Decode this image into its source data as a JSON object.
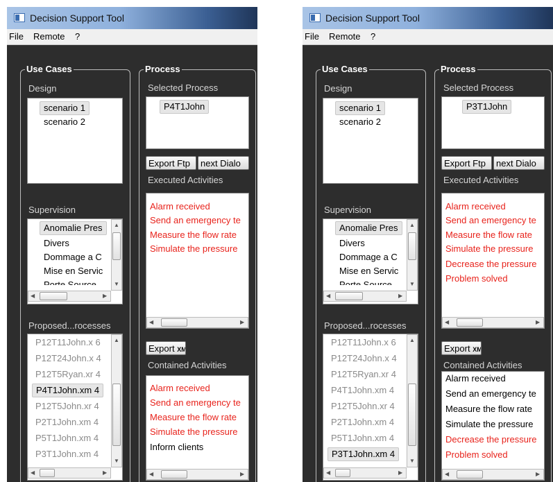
{
  "windows": [
    {
      "title": "Decision Support Tool",
      "menu": [
        "File",
        "Remote",
        "?"
      ],
      "use_cases": {
        "legend": "Use Cases",
        "design_label": "Design",
        "design_items": [
          "scenario 1",
          "scenario 2"
        ],
        "supervision_label": "Supervision",
        "supervision_items": [
          "Anomalie Pres",
          "Divers",
          "Dommage a C",
          "Mise en Servic",
          "Porte Source"
        ],
        "proposed_label": "Proposed...rocesses",
        "proposed_items": [
          "P12T11John.x 6",
          "P12T24John.x 4",
          "P12T5Ryan.xr 4",
          "P4T1John.xm 4",
          "P12T5John.xr 4",
          "P2T1John.xm 4",
          "P5T1John.xm 4",
          "P3T1John.xm 4"
        ],
        "proposed_selected": 3
      },
      "process": {
        "legend": "Process",
        "selected_label": "Selected Process",
        "selected_value": "P4T1John",
        "export_ftp": "Export Ftp",
        "next_dialog": "next Dialo",
        "executed_label": "Executed Activities",
        "executed_items": [
          "Alarm received",
          "Send an emergency te",
          "Measure the flow rate",
          "Simulate the pressure"
        ],
        "export_prefix": "Export",
        "export_suffix": "XMI",
        "contained_label": "Contained Activities",
        "contained_items": [
          {
            "text": "Alarm received",
            "color": "red"
          },
          {
            "text": "Send an emergency te",
            "color": "red"
          },
          {
            "text": "Measure the flow rate",
            "color": "red"
          },
          {
            "text": "Simulate the pressure",
            "color": "red"
          },
          {
            "text": "Inform clients",
            "color": "black"
          }
        ]
      }
    },
    {
      "title": "Decision Support Tool",
      "menu": [
        "File",
        "Remote",
        "?"
      ],
      "use_cases": {
        "legend": "Use Cases",
        "design_label": "Design",
        "design_items": [
          "scenario 1",
          "scenario 2"
        ],
        "supervision_label": "Supervision",
        "supervision_items": [
          "Anomalie Pres",
          "Divers",
          "Dommage a C",
          "Mise en Servic",
          "Porte Source"
        ],
        "proposed_label": "Proposed...rocesses",
        "proposed_items": [
          "P12T11John.x 6",
          "P12T24John.x 4",
          "P12T5Ryan.xr 4",
          "P4T1John.xm 4",
          "P12T5John.xr 4",
          "P2T1John.xm 4",
          "P5T1John.xm 4",
          "P3T1John.xm 4"
        ],
        "proposed_selected": 7
      },
      "process": {
        "legend": "Process",
        "selected_label": "Selected Process",
        "selected_value": "P3T1John",
        "export_ftp": "Export Ftp",
        "next_dialog": "next Dialo",
        "executed_label": "Executed Activities",
        "executed_items": [
          "Alarm received",
          "Send an emergency te",
          "Measure the flow rate",
          "Simulate the pressure",
          "Decrease the pressure",
          "Problem solved"
        ],
        "export_prefix": "Export",
        "export_suffix": "XMI",
        "contained_label": "Contained Activities",
        "contained_items": [
          {
            "text": "Alarm received",
            "color": "black"
          },
          {
            "text": "Send an emergency te",
            "color": "black"
          },
          {
            "text": "Measure the flow rate",
            "color": "black"
          },
          {
            "text": "Simulate the pressure",
            "color": "black"
          },
          {
            "text": "Decrease the pressure",
            "color": "red"
          },
          {
            "text": "Problem solved",
            "color": "red"
          }
        ]
      }
    }
  ],
  "colors": {
    "window_bg": "#2d2d2d",
    "active_text": "#e8231c",
    "inactive_text": "#8a8a8a"
  }
}
